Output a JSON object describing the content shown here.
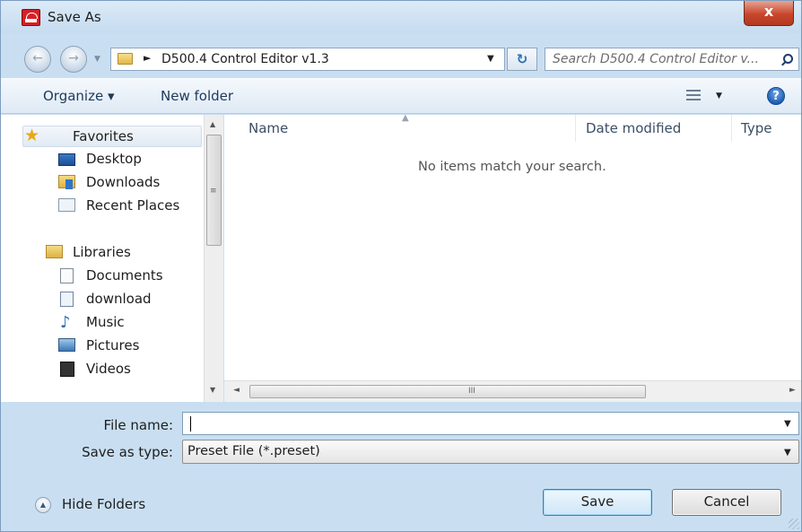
{
  "window": {
    "title": "Save As",
    "close_glyph": "x",
    "app_icon": "app-logo-icon"
  },
  "nav": {
    "back_glyph": "←",
    "forward_glyph": "→",
    "history_glyph": "▼",
    "address": {
      "separator": "►",
      "path": "D500.4 Control Editor v1.3",
      "dropdown_glyph": "▼"
    },
    "refresh_glyph": "↻",
    "search_placeholder": "Search D500.4 Control Editor v..."
  },
  "toolbar": {
    "organize": "Organize ▾",
    "new_folder": "New folder",
    "view_dropdown_glyph": "▼",
    "help_glyph": "?"
  },
  "tree": {
    "favorites": {
      "label": "Favorites",
      "icon": "star-icon",
      "items": [
        {
          "label": "Desktop",
          "icon": "desktop-icon"
        },
        {
          "label": "Downloads",
          "icon": "downloads-folder-icon"
        },
        {
          "label": "Recent Places",
          "icon": "recent-places-icon"
        }
      ]
    },
    "libraries": {
      "label": "Libraries",
      "icon": "libraries-folder-icon",
      "items": [
        {
          "label": "Documents",
          "icon": "document-icon"
        },
        {
          "label": "download",
          "icon": "library-icon"
        },
        {
          "label": "Music",
          "icon": "music-note-icon"
        },
        {
          "label": "Pictures",
          "icon": "picture-icon"
        },
        {
          "label": "Videos",
          "icon": "film-icon"
        }
      ]
    }
  },
  "file_list": {
    "columns": [
      "Name",
      "Date modified",
      "Type"
    ],
    "empty_message": "No items match your search.",
    "scroll_grip": "III"
  },
  "form": {
    "file_name_label": "File name:",
    "file_name_value": "",
    "save_type_label": "Save as type:",
    "save_type_value": "Preset File (*.preset)",
    "dropdown_glyph": "▼"
  },
  "footer": {
    "hide_folders": "Hide Folders",
    "hide_glyph": "▲",
    "save_button": "Save",
    "cancel_button": "Cancel"
  },
  "colors": {
    "accent": "#3c7fb1",
    "chrome": "#c9dff1",
    "close": "#c9462c"
  }
}
